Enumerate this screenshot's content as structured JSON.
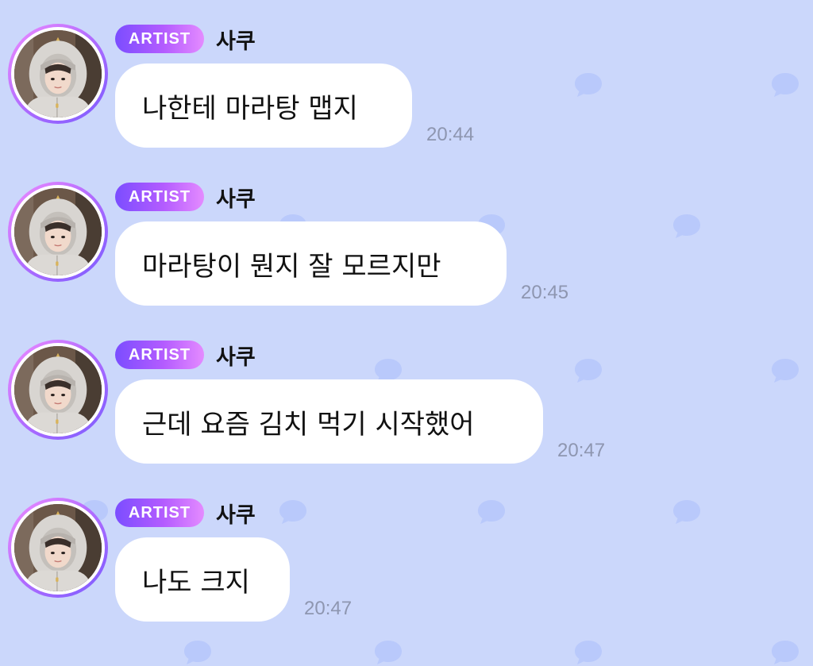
{
  "colors": {
    "background": "#cbd7fb",
    "pattern_bubble": "#b9c9fb",
    "badge_gradient_start": "#7b4dff",
    "badge_gradient_end": "#e48bff",
    "message_bubble": "#ffffff",
    "timestamp": "#8e96b0"
  },
  "messages": [
    {
      "badge": "ARTIST",
      "sender": "사쿠",
      "text": "나한테 마라탕 맵지",
      "time": "20:44",
      "avatar_icon": "profile-photo"
    },
    {
      "badge": "ARTIST",
      "sender": "사쿠",
      "text": "마라탕이 뭔지 잘 모르지만",
      "time": "20:45",
      "avatar_icon": "profile-photo"
    },
    {
      "badge": "ARTIST",
      "sender": "사쿠",
      "text": "근데 요즘 김치 먹기 시작했어",
      "time": "20:47",
      "avatar_icon": "profile-photo"
    },
    {
      "badge": "ARTIST",
      "sender": "사쿠",
      "text": "나도 크지",
      "time": "20:47",
      "avatar_icon": "profile-photo"
    }
  ]
}
